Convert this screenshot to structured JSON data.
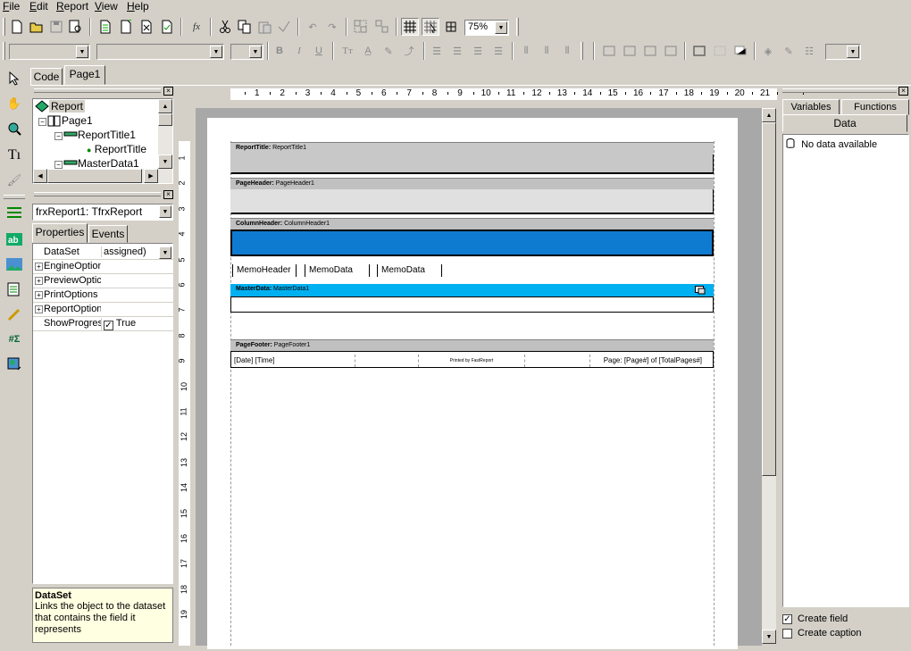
{
  "menu": [
    "File",
    "Edit",
    "Report",
    "View",
    "Help"
  ],
  "toolbar": {
    "zoom_value": "75%",
    "font_name_value": "",
    "font_size_value": "",
    "style_value": "",
    "frame_width_value": "",
    "fx_label": "fx"
  },
  "tabs": {
    "code": "Code",
    "page": "Page1"
  },
  "tree": {
    "items": [
      "Report",
      "Page1",
      "ReportTitle1",
      "ReportTitle",
      "MasterData1"
    ]
  },
  "inspector": {
    "object_selector": "frxReport1: TfrxReport",
    "tab_properties": "Properties",
    "tab_events": "Events",
    "rows": [
      {
        "name": "DataSet",
        "value": "assigned)",
        "expandable": false
      },
      {
        "name": "EngineOption",
        "value": "",
        "expandable": true
      },
      {
        "name": "PreviewOptic",
        "value": "",
        "expandable": true
      },
      {
        "name": "PrintOptions",
        "value": "",
        "expandable": true
      },
      {
        "name": "ReportOption",
        "value": "",
        "expandable": true
      },
      {
        "name": "ShowProgres",
        "value": "True",
        "expandable": false
      }
    ],
    "help_title": "DataSet",
    "help_text": "Links the object to the dataset that contains the field it represents"
  },
  "ruler_h": [
    "1",
    "2",
    "3",
    "4",
    "5",
    "6",
    "7",
    "8",
    "9",
    "10",
    "11",
    "12",
    "13",
    "14",
    "15",
    "16",
    "17",
    "18",
    "19",
    "20",
    "21"
  ],
  "ruler_v": [
    "1",
    "2",
    "3",
    "4",
    "5",
    "6",
    "7",
    "8",
    "9",
    "10",
    "11",
    "12",
    "13",
    "14",
    "15",
    "16",
    "17",
    "18",
    "19"
  ],
  "bands": {
    "report_title": {
      "kind": "ReportTitle:",
      "name": "ReportTitle1"
    },
    "page_header": {
      "kind": "PageHeader:",
      "name": "PageHeader1"
    },
    "column_header": {
      "kind": "ColumnHeader:",
      "name": "ColumnHeader1"
    },
    "master_data": {
      "kind": "MasterData:",
      "name": "MasterData1"
    },
    "page_footer": {
      "kind": "PageFooter:",
      "name": "PageFooter1"
    }
  },
  "memos": [
    "MemoHeader",
    "MemoData",
    "MemoData"
  ],
  "footer_cells": {
    "datetime": "[Date] [Time]",
    "printed_by": "Printed by FastReport",
    "page": "Page: [Page#] of [TotalPages#]"
  },
  "right_panel": {
    "tab_variables": "Variables",
    "tab_functions": "Functions",
    "header": "Data",
    "no_data": "No data available",
    "create_field": "Create field",
    "create_field_checked": true,
    "create_caption": "Create caption",
    "create_caption_checked": false
  },
  "colors": {
    "column_header_fill": "#0f7bd0",
    "master_data_header": "#00b0f0",
    "face": "#d4d0c8"
  }
}
